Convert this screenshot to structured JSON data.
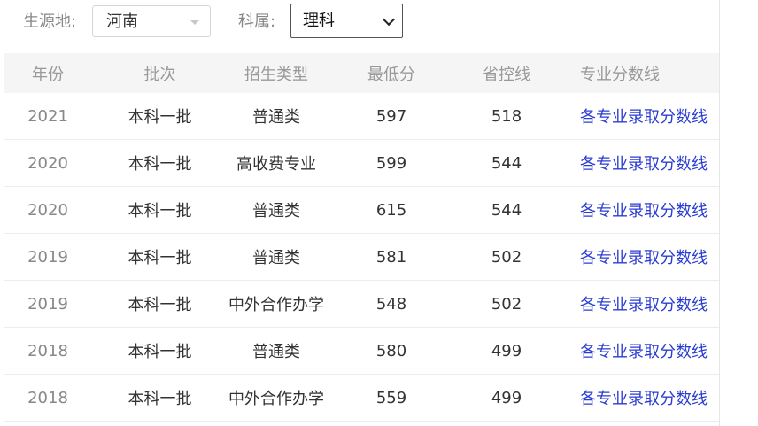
{
  "filters": {
    "origin_label": "生源地:",
    "origin_value": "河南",
    "category_label": "科属:",
    "category_value": "理科"
  },
  "table": {
    "headers": [
      "年份",
      "批次",
      "招生类型",
      "最低分",
      "省控线",
      "专业分数线"
    ],
    "rows": [
      {
        "year": "2021",
        "batch": "本科一批",
        "type": "普通类",
        "min_score": "597",
        "control_line": "518",
        "link": "各专业录取分数线"
      },
      {
        "year": "2020",
        "batch": "本科一批",
        "type": "高收费专业",
        "min_score": "599",
        "control_line": "544",
        "link": "各专业录取分数线"
      },
      {
        "year": "2020",
        "batch": "本科一批",
        "type": "普通类",
        "min_score": "615",
        "control_line": "544",
        "link": "各专业录取分数线"
      },
      {
        "year": "2019",
        "batch": "本科一批",
        "type": "普通类",
        "min_score": "581",
        "control_line": "502",
        "link": "各专业录取分数线"
      },
      {
        "year": "2019",
        "batch": "本科一批",
        "type": "中外合作办学",
        "min_score": "548",
        "control_line": "502",
        "link": "各专业录取分数线"
      },
      {
        "year": "2018",
        "batch": "本科一批",
        "type": "普通类",
        "min_score": "580",
        "control_line": "499",
        "link": "各专业录取分数线"
      },
      {
        "year": "2018",
        "batch": "本科一批",
        "type": "中外合作办学",
        "min_score": "559",
        "control_line": "499",
        "link": "各专业录取分数线"
      }
    ]
  },
  "colors": {
    "link": "#2b3dd1",
    "header_bg": "#f5f5f5",
    "muted": "#999999"
  }
}
